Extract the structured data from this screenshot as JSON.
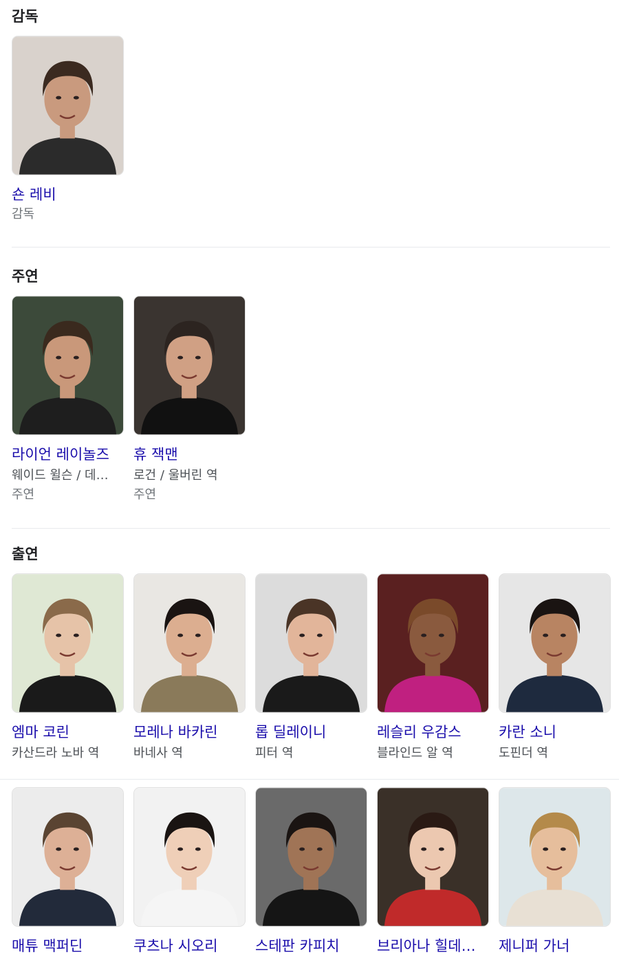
{
  "director": {
    "title": "감독",
    "people": [
      {
        "name": "숀 레비",
        "tag": "감독",
        "bg": "#d9d2cc",
        "skin": "#c99a7e",
        "hair": "#3b2a20",
        "shirt": "#2b2b2b"
      }
    ]
  },
  "lead": {
    "title": "주연",
    "people": [
      {
        "name": "라이언 레이놀즈",
        "role": "웨이드 윌슨 / 데…",
        "tag": "주연",
        "bg": "#3c4a3a",
        "skin": "#c9987a",
        "hair": "#3a2a1e",
        "shirt": "#1e1e1e"
      },
      {
        "name": "휴 잭맨",
        "role": "로건 / 울버린 역",
        "tag": "주연",
        "bg": "#3a3430",
        "skin": "#d0a084",
        "hair": "#2c2420",
        "shirt": "#111111"
      }
    ]
  },
  "cast": {
    "title": "출연",
    "row1": [
      {
        "name": "엠마 코린",
        "role": "카산드라 노바 역",
        "bg": "#dfe8d4",
        "skin": "#e6c3a8",
        "hair": "#8a6a4a",
        "shirt": "#1a1a1a"
      },
      {
        "name": "모레나 바카린",
        "role": "바네사 역",
        "bg": "#e9e7e3",
        "skin": "#dcae90",
        "hair": "#1a1412",
        "shirt": "#8a7a5a"
      },
      {
        "name": "롭 딜레이니",
        "role": "피터 역",
        "bg": "#dcdcdc",
        "skin": "#e2b59a",
        "hair": "#4a3426",
        "shirt": "#1a1a1a"
      },
      {
        "name": "레슬리 우감스",
        "role": "블라인드 알 역",
        "bg": "#5a2020",
        "skin": "#8a5a3e",
        "hair": "#7a4a2a",
        "shirt": "#c02080"
      },
      {
        "name": "카란 소니",
        "role": "도핀더 역",
        "bg": "#e6e6e6",
        "skin": "#b88462",
        "hair": "#1a1412",
        "shirt": "#1e2a3e"
      }
    ],
    "row2": [
      {
        "name": "매튜 맥퍼딘",
        "bg": "#ececec",
        "skin": "#ddb096",
        "hair": "#5a4432",
        "shirt": "#222a3a"
      },
      {
        "name": "쿠츠나 시오리",
        "bg": "#f2f2f2",
        "skin": "#efcfb8",
        "hair": "#1a1412",
        "shirt": "#f5f5f5"
      },
      {
        "name": "스테판 카피치",
        "bg": "#6a6a6a",
        "skin": "#a07456",
        "hair": "#1a1412",
        "shirt": "#151515"
      },
      {
        "name": "브리아나 힐데…",
        "bg": "#3a3028",
        "skin": "#ecc8b0",
        "hair": "#2a1a14",
        "shirt": "#c02a2a"
      },
      {
        "name": "제니퍼 가너",
        "bg": "#dde7ea",
        "skin": "#e6be9c",
        "hair": "#b48a4a",
        "shirt": "#e8e0d4"
      }
    ]
  }
}
